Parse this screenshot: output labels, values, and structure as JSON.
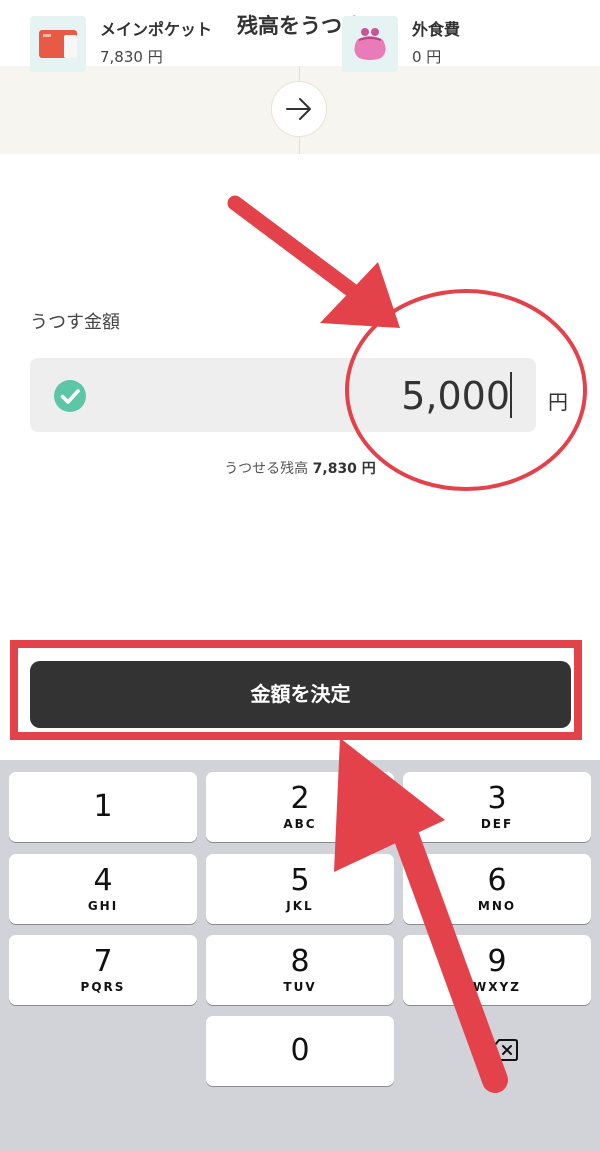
{
  "header": {
    "title": "残高をうつす",
    "close_icon": "close-icon"
  },
  "transfer": {
    "from": {
      "name": "メインポケット",
      "balance": "7,830 円",
      "icon": "card-icon"
    },
    "to": {
      "name": "外食費",
      "balance": "0 円",
      "icon": "purse-icon"
    },
    "arrow_icon": "arrow-right-icon"
  },
  "amount": {
    "label": "うつす金額",
    "value": "5,000",
    "unit": "円",
    "available_label": "うつせる残高",
    "available_value": "7,830 円"
  },
  "confirm": {
    "label": "金額を決定"
  },
  "keypad": {
    "keys": [
      {
        "num": "1",
        "letters": ""
      },
      {
        "num": "2",
        "letters": "ABC"
      },
      {
        "num": "3",
        "letters": "DEF"
      },
      {
        "num": "4",
        "letters": "GHI"
      },
      {
        "num": "5",
        "letters": "JKL"
      },
      {
        "num": "6",
        "letters": "MNO"
      },
      {
        "num": "7",
        "letters": "PQRS"
      },
      {
        "num": "8",
        "letters": "TUV"
      },
      {
        "num": "9",
        "letters": "WXYZ"
      },
      {
        "num": "0",
        "letters": ""
      }
    ]
  },
  "colors": {
    "accent": "#e3424b",
    "check": "#5cc6a7",
    "button": "#333333",
    "keypad_bg": "#d1d3d9"
  }
}
